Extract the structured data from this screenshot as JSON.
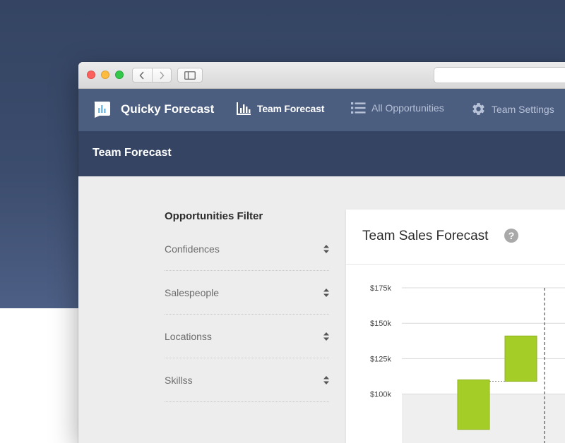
{
  "app": {
    "brand": "Quicky Forecast",
    "nav": [
      {
        "label": "Team Forecast",
        "icon": "bar-chart-icon",
        "active": true
      },
      {
        "label": "All Opportunities",
        "icon": "list-icon",
        "active": false
      },
      {
        "label": "Team Settings",
        "icon": "gear-icon",
        "active": false
      }
    ]
  },
  "page": {
    "title": "Team Forecast"
  },
  "filter": {
    "title": "Opportunities Filter",
    "items": [
      "Confidences",
      "Salespeople",
      "Locationss",
      "Skillss"
    ]
  },
  "card": {
    "title": "Team Sales Forecast"
  },
  "colors": {
    "nav_bg": "#4c5e80",
    "subheader_bg": "#344462",
    "accent_green": "#a5cd27",
    "brand_icon": "#6fc1f0"
  },
  "chart_data": {
    "type": "bar",
    "yticks": [
      "$175k",
      "$150k",
      "$125k",
      "$100k"
    ],
    "ylim": [
      100,
      175
    ],
    "bars": [
      {
        "bottom": 75,
        "top": 110
      },
      {
        "bottom": 109,
        "top": 141
      }
    ]
  }
}
